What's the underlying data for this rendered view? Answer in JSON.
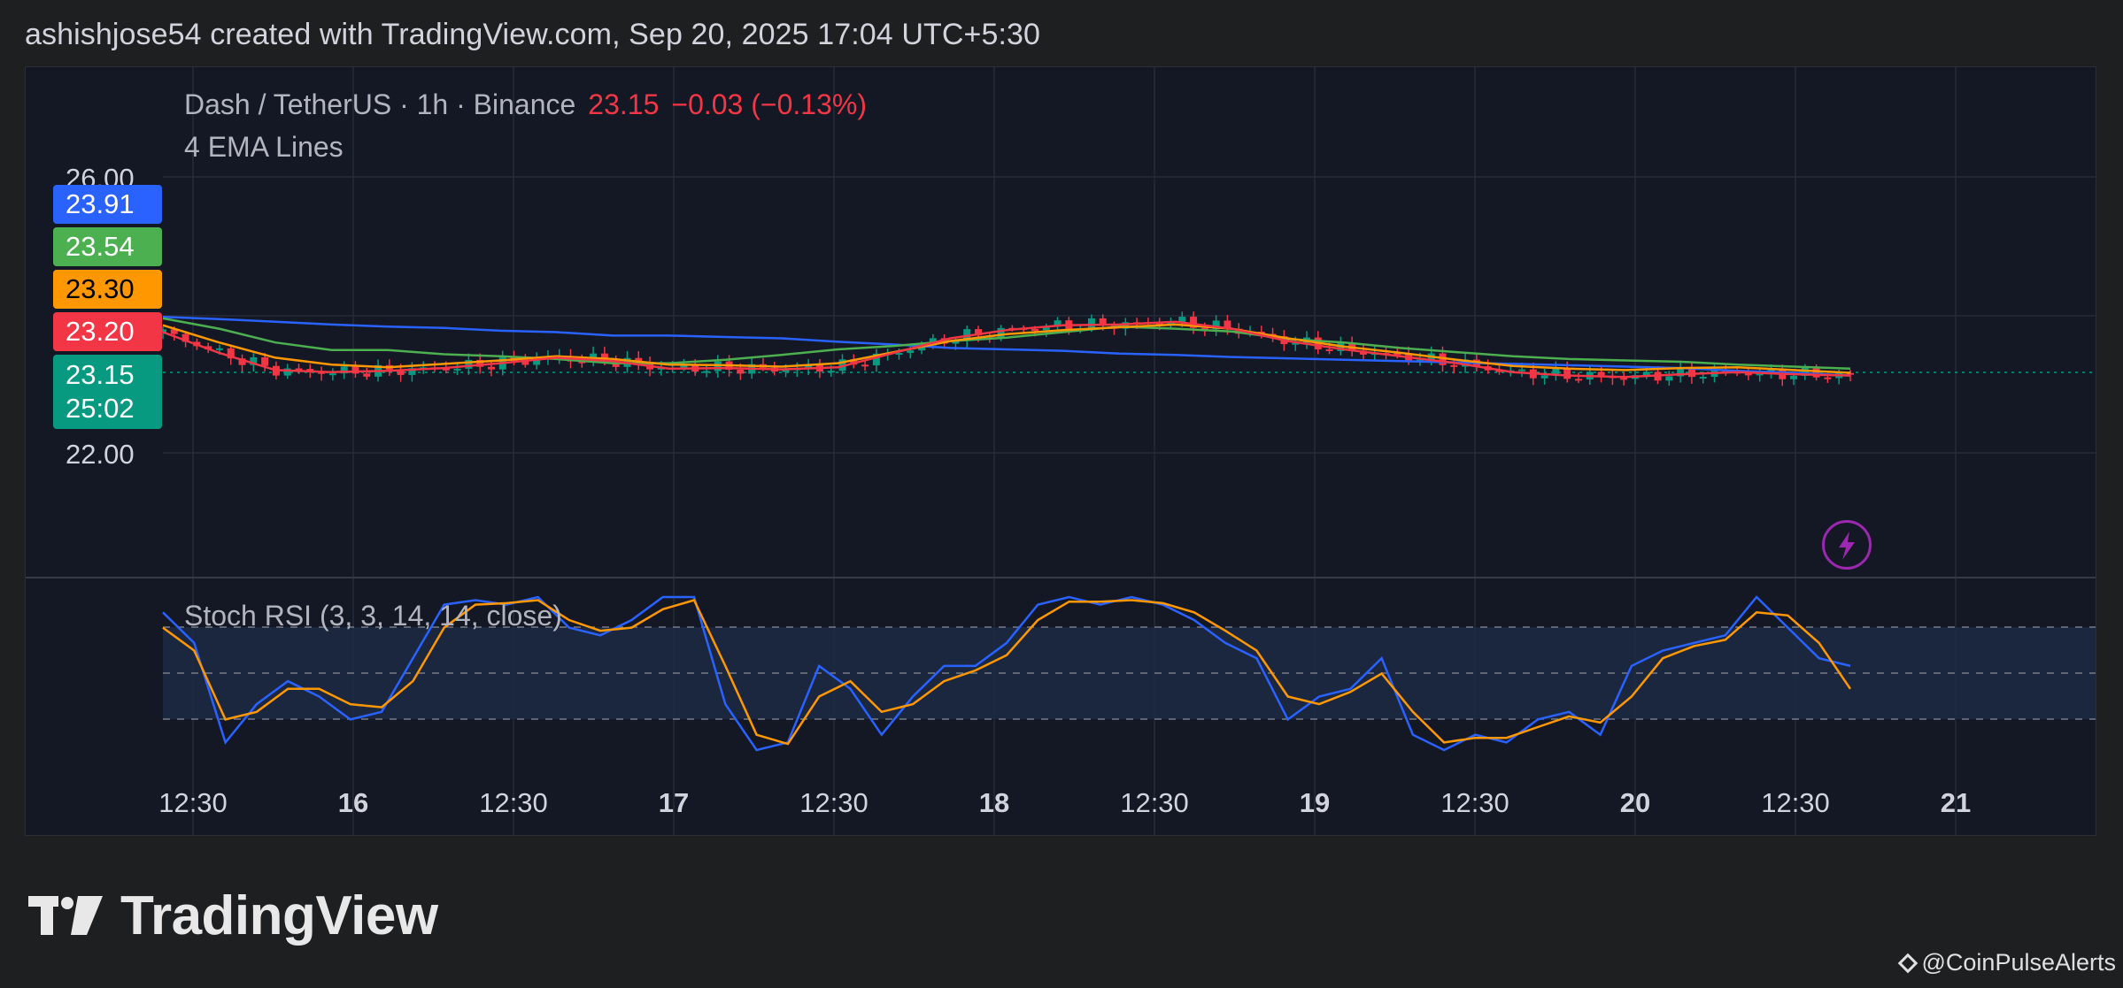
{
  "header": {
    "text": "ashishjose54 created with TradingView.com, Sep 20, 2025 17:04 UTC+5:30"
  },
  "legend": {
    "symbol": "Dash / TetherUS · 1h · Binance",
    "price": "23.15",
    "change": "−0.03 (−0.13%)",
    "ema_label": "4 EMA Lines",
    "stoch_label": "Stoch RSI (3, 3, 14, 14, close)"
  },
  "price_tags": [
    {
      "text": "23.91",
      "bg": "#2962ff",
      "fg": "#ffffff"
    },
    {
      "text": "23.54",
      "bg": "#4caf50",
      "fg": "#ffffff"
    },
    {
      "text": "23.30",
      "bg": "#ff9800",
      "fg": "#000000"
    },
    {
      "text": "23.20",
      "bg": "#f23645",
      "fg": "#ffffff"
    },
    {
      "text": "23.15",
      "bg": "#089981",
      "fg": "#ffffff",
      "sub": "25:02"
    }
  ],
  "y_axis": {
    "labels": [
      "26.00",
      "22.00"
    ]
  },
  "x_axis": {
    "labels": [
      "12:30",
      "16",
      "12:30",
      "17",
      "12:30",
      "18",
      "12:30",
      "19",
      "12:30",
      "20",
      "12:30",
      "21"
    ]
  },
  "colors": {
    "ema1": "#2962ff",
    "ema2": "#4caf50",
    "ema3": "#ff9800",
    "ema4": "#f23645",
    "up": "#089981",
    "down": "#f23645",
    "stoch_k": "#2962ff",
    "stoch_d": "#ff9800"
  },
  "brand": {
    "logo": "TradingView",
    "watermark": "@CoinPulseAlerts"
  },
  "chart_data": [
    {
      "type": "line",
      "title": "Dash / TetherUS · 1h · Binance",
      "ylim": [
        22.0,
        26.0
      ],
      "x": [
        "12:30",
        "16",
        "12:30",
        "17",
        "12:30",
        "18",
        "12:30",
        "19",
        "12:30",
        "20",
        "12:30"
      ],
      "series": [
        {
          "name": "",
          "values": [
            23.97,
            23.94,
            23.9,
            23.86,
            23.83,
            23.81,
            23.77,
            23.75,
            23.7,
            23.7,
            23.68,
            23.66,
            23.61,
            23.57,
            23.52,
            23.5,
            23.48,
            23.44,
            23.42,
            23.39,
            23.37,
            23.35,
            23.33,
            23.31,
            23.29,
            23.27,
            23.25,
            23.23,
            23.19,
            23.16,
            23.12
          ]
        },
        {
          "name": "",
          "values": [
            23.95,
            23.8,
            23.6,
            23.49,
            23.49,
            23.43,
            23.4,
            23.36,
            23.3,
            23.3,
            23.35,
            23.42,
            23.5,
            23.55,
            23.62,
            23.67,
            23.75,
            23.83,
            23.8,
            23.76,
            23.65,
            23.6,
            23.52,
            23.46,
            23.4,
            23.36,
            23.34,
            23.32,
            23.28,
            23.25,
            23.22
          ]
        },
        {
          "name": "",
          "values": [
            23.85,
            23.6,
            23.38,
            23.28,
            23.24,
            23.29,
            23.34,
            23.4,
            23.36,
            23.28,
            23.27,
            23.25,
            23.3,
            23.46,
            23.62,
            23.72,
            23.78,
            23.82,
            23.86,
            23.8,
            23.66,
            23.54,
            23.45,
            23.35,
            23.26,
            23.22,
            23.2,
            23.23,
            23.24,
            23.2,
            23.16
          ]
        },
        {
          "name": "",
          "values": [
            23.75,
            23.45,
            23.2,
            23.17,
            23.19,
            23.23,
            23.3,
            23.38,
            23.33,
            23.22,
            23.23,
            23.21,
            23.24,
            23.45,
            23.66,
            23.78,
            23.85,
            23.86,
            23.9,
            23.8,
            23.62,
            23.5,
            23.4,
            23.3,
            23.17,
            23.12,
            23.1,
            23.14,
            23.17,
            23.14,
            23.12
          ]
        }
      ]
    },
    {
      "type": "line",
      "title": "Stoch RSI (3, 3, 14, 14, close)",
      "ylim": [
        0,
        100
      ],
      "series": [
        {
          "name": "",
          "values": [
            90,
            70,
            5,
            30,
            45,
            35,
            20,
            25,
            60,
            95,
            98,
            95,
            100,
            80,
            75,
            85,
            100,
            100,
            30,
            0,
            5,
            55,
            40,
            10,
            35,
            55,
            55,
            70,
            95,
            100,
            95,
            100,
            95,
            85,
            70,
            60,
            20,
            35,
            40,
            60,
            10,
            0,
            10,
            5,
            20,
            25,
            10,
            55,
            65,
            70,
            75,
            100,
            80,
            60,
            55
          ]
        },
        {
          "name": "",
          "values": [
            80,
            65,
            20,
            25,
            40,
            40,
            30,
            28,
            45,
            80,
            95,
            96,
            98,
            85,
            78,
            80,
            92,
            98,
            55,
            10,
            4,
            35,
            45,
            25,
            30,
            45,
            52,
            62,
            85,
            97,
            97,
            98,
            96,
            90,
            78,
            65,
            35,
            30,
            38,
            50,
            25,
            5,
            8,
            8,
            15,
            22,
            18,
            35,
            60,
            68,
            72,
            90,
            88,
            70,
            40
          ]
        }
      ]
    }
  ]
}
